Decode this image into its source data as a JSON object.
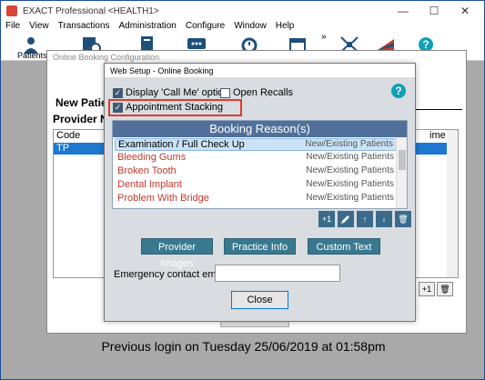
{
  "app": {
    "title": "EXACT Professional <HEALTH1>",
    "menu": [
      "File",
      "View",
      "Transactions",
      "Administration",
      "Configure",
      "Window",
      "Help"
    ],
    "toolbar_label": "Patients",
    "chevron": "»"
  },
  "config": {
    "title": "Online Booking Configuration",
    "new_patient": "New Patie",
    "provider": "Provider No",
    "columns": [
      "Code",
      "ime"
    ],
    "rows": [
      "TP"
    ],
    "btn_plus": "+1",
    "btn_delete": "trash-icon"
  },
  "login_message": "Previous login on Tuesday 25/06/2019 at 01:58pm",
  "dialog": {
    "title": "Web Setup - Online Booking",
    "display_call_me": "Display 'Call Me' option",
    "open_recalls": "Open Recalls",
    "appointment_stacking": "Appointment Stacking",
    "display_call_me_checked": true,
    "open_recalls_checked": false,
    "appointment_stacking_checked": true,
    "booking_header": "Booking Reason(s)",
    "reasons": [
      {
        "name": "Examination / Full Check Up",
        "type": "New/Existing Patients"
      },
      {
        "name": "Bleeding Gums",
        "type": "New/Existing Patients"
      },
      {
        "name": "Broken Tooth",
        "type": "New/Existing Patients"
      },
      {
        "name": "Dental Implant",
        "type": "New/Existing Patients"
      },
      {
        "name": "Problem With Bridge",
        "type": "New/Existing Patients"
      }
    ],
    "icon_buttons": [
      "+1",
      "edit-icon",
      "arrow-up-icon",
      "arrow-down-icon",
      "trash-icon"
    ],
    "plus_label": "+1",
    "provider_images": "Provider Images",
    "practice_info": "Practice Info",
    "custom_text": "Custom Text",
    "email_label": "Emergency contact email",
    "email_value": "",
    "close": "Close",
    "help": "?"
  },
  "colors": {
    "highlight": "#e03a2e",
    "button": "#39798f",
    "header": "#50709a",
    "selection": "#1e78d0"
  }
}
